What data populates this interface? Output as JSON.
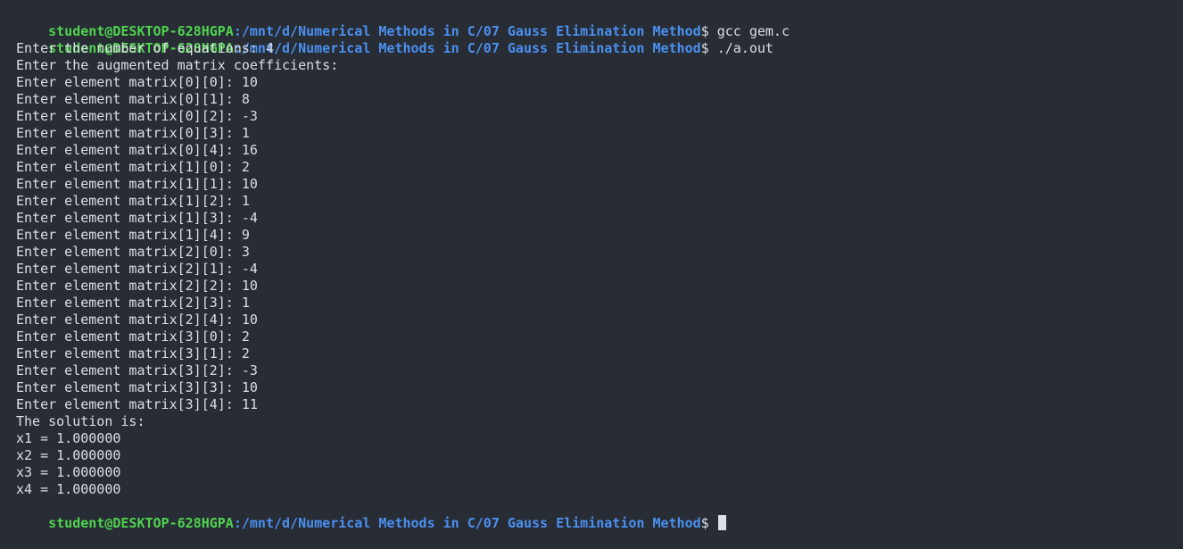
{
  "colors": {
    "background": "#282c34",
    "user_host": "#4fd34f",
    "path": "#4a90f0",
    "text": "#dcdfe4"
  },
  "prompt": {
    "user_host": "student@DESKTOP-628HGPA",
    "path": ":/mnt/d/Numerical Methods in C/07 Gauss Elimination Method",
    "symbol": "$"
  },
  "commands": [
    " gcc gem.c",
    " ./a.out",
    " "
  ],
  "output": [
    "Enter the number of equations: 4",
    "Enter the augmented matrix coefficients:",
    "Enter element matrix[0][0]: 10",
    "Enter element matrix[0][1]: 8",
    "Enter element matrix[0][2]: -3",
    "Enter element matrix[0][3]: 1",
    "Enter element matrix[0][4]: 16",
    "Enter element matrix[1][0]: 2",
    "Enter element matrix[1][1]: 10",
    "Enter element matrix[1][2]: 1",
    "Enter element matrix[1][3]: -4",
    "Enter element matrix[1][4]: 9",
    "Enter element matrix[2][0]: 3",
    "Enter element matrix[2][1]: -4",
    "Enter element matrix[2][2]: 10",
    "Enter element matrix[2][3]: 1",
    "Enter element matrix[2][4]: 10",
    "Enter element matrix[3][0]: 2",
    "Enter element matrix[3][1]: 2",
    "Enter element matrix[3][2]: -3",
    "Enter element matrix[3][3]: 10",
    "Enter element matrix[3][4]: 11",
    "The solution is:",
    "x1 = 1.000000",
    "x2 = 1.000000",
    "x3 = 1.000000",
    "x4 = 1.000000"
  ]
}
